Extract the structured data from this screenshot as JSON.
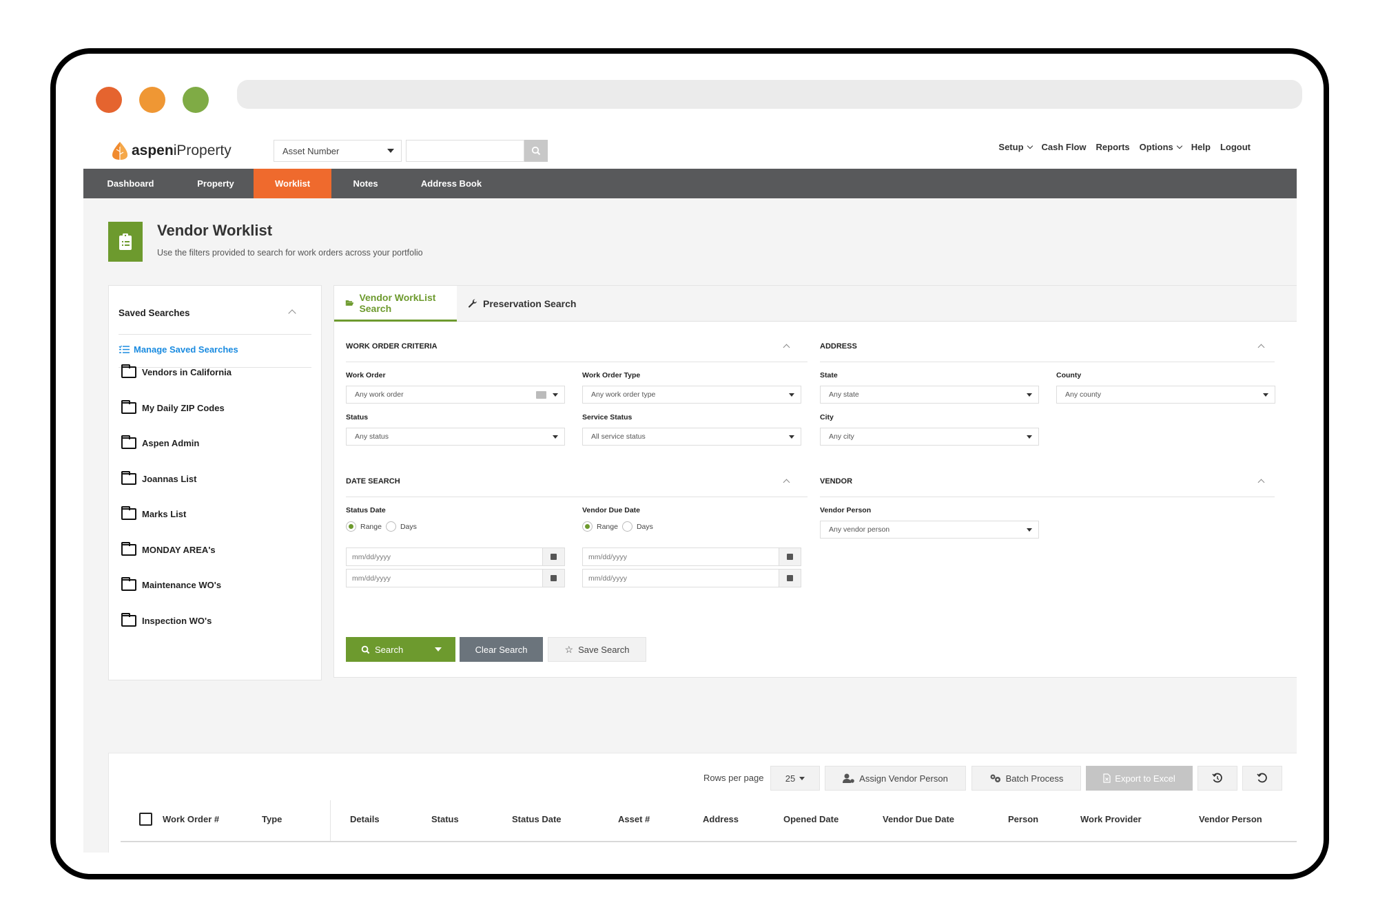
{
  "window": {
    "traffic_lights": [
      {
        "name": "close",
        "color": "#e5642f"
      },
      {
        "name": "minimize",
        "color": "#ef9734"
      },
      {
        "name": "maximize",
        "color": "#7fab45"
      }
    ]
  },
  "header": {
    "logo_prefix": "aspen",
    "logo_i": "i",
    "logo_suffix": "Property",
    "search_type": "Asset Number",
    "search_value": "",
    "search_icon": "search-icon",
    "links": [
      {
        "label": "Setup",
        "dropdown": true
      },
      {
        "label": "Cash Flow",
        "dropdown": false
      },
      {
        "label": "Reports",
        "dropdown": false
      },
      {
        "label": "Options",
        "dropdown": true
      },
      {
        "label": "Help",
        "dropdown": false
      },
      {
        "label": "Logout",
        "dropdown": false
      }
    ]
  },
  "nav": {
    "items": [
      {
        "label": "Dashboard",
        "active": false
      },
      {
        "label": "Property",
        "active": false
      },
      {
        "label": "Worklist",
        "active": true
      },
      {
        "label": "Notes",
        "active": false
      },
      {
        "label": "Address Book",
        "active": false
      }
    ]
  },
  "colors": {
    "brand_orange": "#ef6a2d",
    "brand_green": "#6d9a2e",
    "nav_bg": "#58595b",
    "link_blue": "#1a8be0"
  },
  "page": {
    "title": "Vendor Worklist",
    "subtitle": "Use the filters provided to search for work orders across your portfolio",
    "icon": "clipboard-list-icon"
  },
  "saved_searches": {
    "heading": "Saved Searches",
    "manage_label": "Manage Saved Searches",
    "items": [
      "Vendors in California",
      "My Daily ZIP Codes",
      "Aspen Admin",
      "Joannas List",
      "Marks List",
      "MONDAY AREA's",
      "Maintenance WO's",
      "Inspection WO's"
    ]
  },
  "search_tabs": [
    {
      "label": "Vendor WorkList Search",
      "icon": "folder-open-icon",
      "active": true
    },
    {
      "label": "Preservation Search",
      "icon": "wrench-icon",
      "active": false
    }
  ],
  "work_order_criteria": {
    "heading": "WORK ORDER CRITERIA",
    "fields": {
      "work_order": {
        "label": "Work Order",
        "placeholder": "Any work order"
      },
      "work_order_type": {
        "label": "Work Order Type",
        "placeholder": "Any work order type"
      },
      "status": {
        "label": "Status",
        "placeholder": "Any status"
      },
      "service_status": {
        "label": "Service Status",
        "placeholder": "All service status"
      }
    }
  },
  "address": {
    "heading": "ADDRESS",
    "fields": {
      "state": {
        "label": "State",
        "placeholder": "Any state"
      },
      "county": {
        "label": "County",
        "placeholder": "Any county"
      },
      "city": {
        "label": "City",
        "placeholder": "Any city"
      }
    }
  },
  "date_search": {
    "heading": "DATE SEARCH",
    "status_date": {
      "label": "Status Date",
      "mode": "Range",
      "options": [
        "Range",
        "Days"
      ],
      "from_placeholder": "mm/dd/yyyy",
      "to_placeholder": "mm/dd/yyyy"
    },
    "vendor_due_date": {
      "label": "Vendor Due Date",
      "mode": "Range",
      "options": [
        "Range",
        "Days"
      ],
      "from_placeholder": "mm/dd/yyyy",
      "to_placeholder": "mm/dd/yyyy"
    }
  },
  "vendor": {
    "heading": "VENDOR",
    "vendor_person": {
      "label": "Vendor Person",
      "placeholder": "Any vendor person"
    }
  },
  "actions": {
    "search": "Search",
    "clear": "Clear Search",
    "save": "Save Search"
  },
  "results": {
    "rows_per_page_label": "Rows per page",
    "rows_per_page": "25",
    "assign_vendor": "Assign Vendor Person",
    "batch_process": "Batch Process",
    "export": "Export to Excel",
    "export_disabled": true,
    "columns": [
      "Work Order #",
      "Type",
      "Details",
      "Status",
      "Status Date",
      "Asset #",
      "Address",
      "Opened Date",
      "Vendor Due Date",
      "Person",
      "Work Provider",
      "Vendor Person"
    ]
  }
}
